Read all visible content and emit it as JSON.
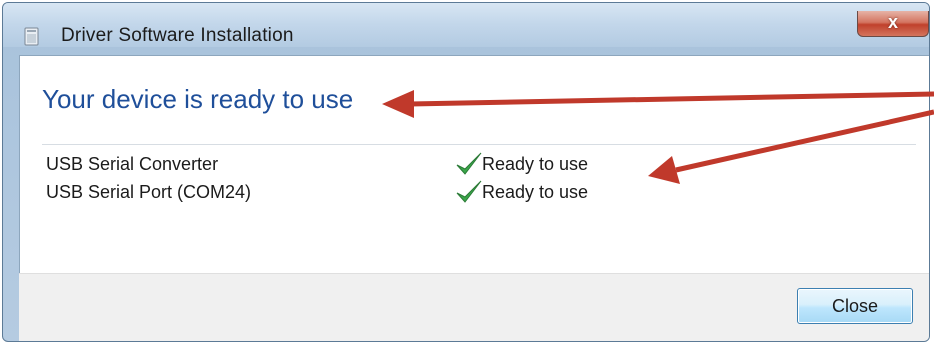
{
  "window": {
    "title": "Driver Software Installation",
    "close_glyph": "x"
  },
  "content": {
    "heading": "Your device is ready to use",
    "devices": [
      {
        "name": "USB Serial Converter",
        "status": "Ready to use",
        "status_icon": "check-icon"
      },
      {
        "name": "USB Serial Port (COM24)",
        "status": "Ready to use",
        "status_icon": "check-icon"
      }
    ]
  },
  "footer": {
    "close_label": "Close"
  },
  "colors": {
    "heading": "#1f4f9a",
    "check": "#3aa64a",
    "annotation_arrow": "#c0392b"
  }
}
